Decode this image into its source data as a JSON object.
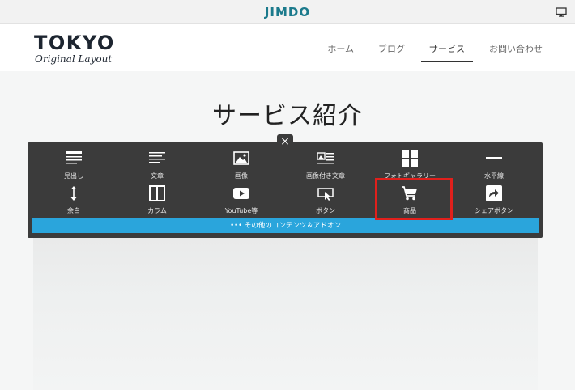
{
  "topbar": {
    "brand": "JIMDO",
    "monitor_icon": "monitor-icon"
  },
  "logo": {
    "main": "TOKYO",
    "sub": "Original Layout"
  },
  "nav": [
    {
      "label": "ホーム",
      "active": false
    },
    {
      "label": "ブログ",
      "active": false
    },
    {
      "label": "サービス",
      "active": true
    },
    {
      "label": "お問い合わせ",
      "active": false
    }
  ],
  "page_title": "サービス紹介",
  "toolbar": {
    "close_label": "×",
    "items": [
      {
        "label": "見出し",
        "icon": "heading-icon"
      },
      {
        "label": "文章",
        "icon": "text-icon"
      },
      {
        "label": "画像",
        "icon": "image-icon"
      },
      {
        "label": "画像付き文章",
        "icon": "image-text-icon"
      },
      {
        "label": "フォトギャラリー",
        "icon": "gallery-icon"
      },
      {
        "label": "水平線",
        "icon": "horizontal-line-icon"
      },
      {
        "label": "余白",
        "icon": "spacer-icon"
      },
      {
        "label": "カラム",
        "icon": "column-icon"
      },
      {
        "label": "YouTube等",
        "icon": "youtube-icon"
      },
      {
        "label": "ボタン",
        "icon": "button-icon"
      },
      {
        "label": "商品",
        "icon": "cart-icon"
      },
      {
        "label": "シェアボタン",
        "icon": "share-icon"
      }
    ],
    "more_label": "••• その他のコンテンツ＆アドオン"
  },
  "colors": {
    "brand": "#1b7a8c",
    "panel": "#3b3b3b",
    "more_bar": "#2aa5dc",
    "highlight": "#e0201c"
  }
}
